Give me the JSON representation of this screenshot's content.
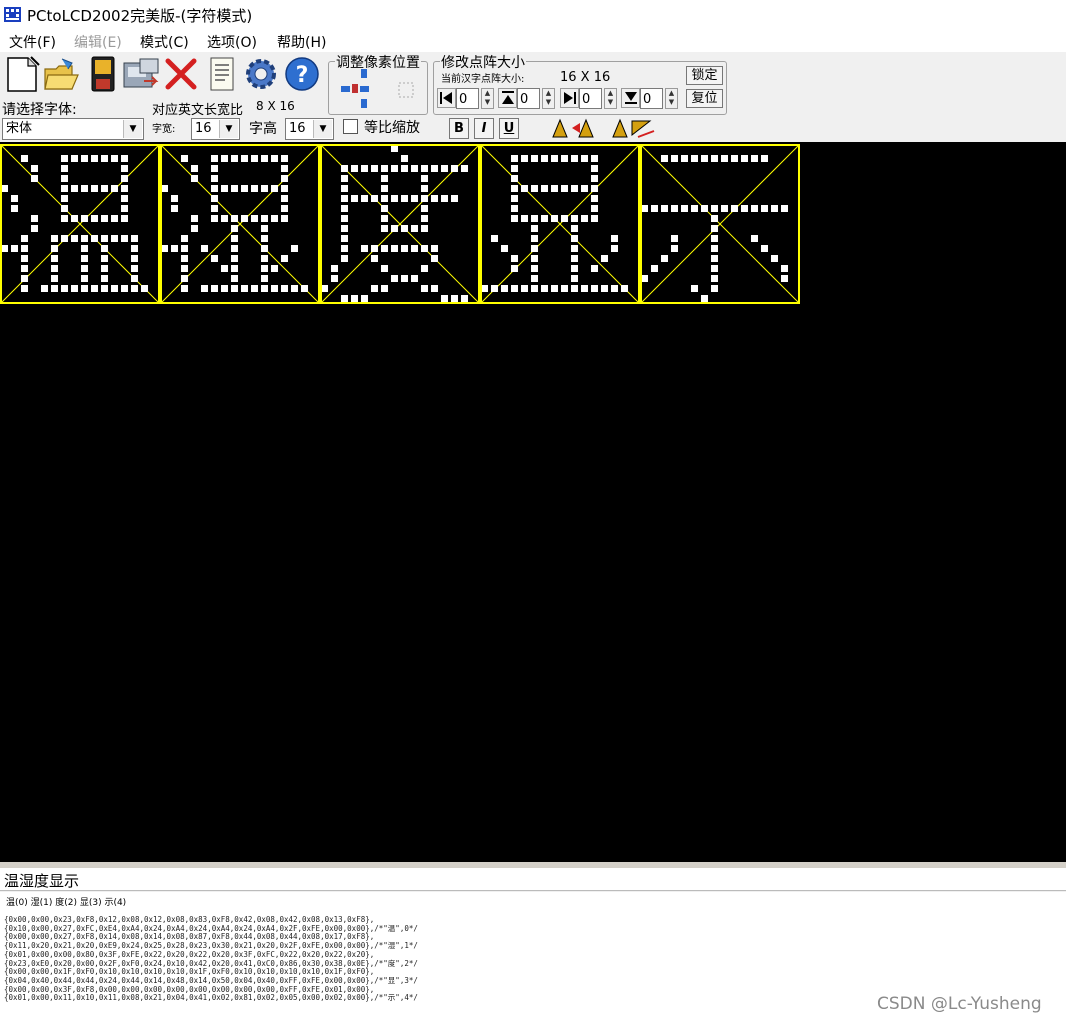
{
  "window": {
    "title": "PCtoLCD2002完美版-(字符模式)"
  },
  "menu": [
    {
      "label": "文件(F)",
      "enabled": true
    },
    {
      "label": "编辑(E)",
      "enabled": false
    },
    {
      "label": "模式(C)",
      "enabled": true
    },
    {
      "label": "选项(O)",
      "enabled": true
    },
    {
      "label": "帮助(H)",
      "enabled": true
    }
  ],
  "toolbar": {
    "icons": [
      "new-file-icon",
      "open-folder-icon",
      "save-icon",
      "generate-icon",
      "delete-icon",
      "notes-icon",
      "settings-gear-icon",
      "help-icon"
    ],
    "adjust_pixel_title": "调整像素位置",
    "modify_size_title": "修改点阵大小",
    "current_size_label": "当前汉字点阵大小:",
    "current_size_value": "16 X 16",
    "lock_label": "锁定",
    "reset_label": "复位",
    "spin_values": [
      "0",
      "0",
      "0",
      "0"
    ]
  },
  "font_panel": {
    "choose_font_label": "请选择字体:",
    "english_ratio_label": "对应英文长宽比",
    "english_ratio_value": "8 X 16",
    "font_name": "宋体",
    "width_label": "字宽:",
    "width_value": "16",
    "height_label": "字高",
    "height_value": "16",
    "proportional_label": "等比缩放",
    "proportional_checked": false,
    "bold_label": "B",
    "italic_label": "I",
    "underline_label": "U"
  },
  "canvas": {
    "characters": [
      "温",
      "湿",
      "度",
      "显",
      "示"
    ],
    "border_color": "#ffff00",
    "dot_color": "#ffffff",
    "background": "#000000"
  },
  "input_text": "温湿度显示",
  "output": {
    "index_line": "温(0) 湿(1) 度(2) 显(3) 示(4)",
    "code_lines": [
      "{0x00,0x00,0x23,0xF8,0x12,0x08,0x12,0x08,0x83,0xF8,0x42,0x08,0x42,0x08,0x13,0xF8},",
      "{0x10,0x00,0x27,0xFC,0xE4,0xA4,0x24,0xA4,0x24,0xA4,0x24,0xA4,0x2F,0xFE,0x00,0x00},/*\"温\",0*/",
      "{0x00,0x00,0x27,0xF8,0x14,0x08,0x14,0x08,0x87,0xF8,0x44,0x08,0x44,0x08,0x17,0xF8},",
      "{0x11,0x20,0x21,0x20,0xE9,0x24,0x25,0x28,0x23,0x30,0x21,0x20,0x2F,0xFE,0x00,0x00},/*\"湿\",1*/",
      "{0x01,0x00,0x00,0x80,0x3F,0xFE,0x22,0x20,0x22,0x20,0x3F,0xFC,0x22,0x20,0x22,0x20},",
      "{0x23,0xE0,0x20,0x00,0x2F,0xF0,0x24,0x10,0x42,0x20,0x41,0xC0,0x86,0x30,0x38,0x0E},/*\"度\",2*/",
      "{0x00,0x00,0x1F,0xF0,0x10,0x10,0x10,0x10,0x1F,0xF0,0x10,0x10,0x10,0x10,0x1F,0xF0},",
      "{0x04,0x40,0x44,0x44,0x24,0x44,0x14,0x48,0x14,0x50,0x04,0x40,0xFF,0xFE,0x00,0x00},/*\"显\",3*/",
      "{0x00,0x00,0x3F,0xF8,0x00,0x00,0x00,0x00,0x00,0x00,0x00,0x00,0xFF,0xFE,0x01,0x00},",
      "{0x01,0x00,0x11,0x10,0x11,0x08,0x21,0x04,0x41,0x02,0x81,0x02,0x05,0x00,0x02,0x00},/*\"示\",4*/"
    ]
  },
  "watermark": "CSDN @Lc-Yusheng"
}
